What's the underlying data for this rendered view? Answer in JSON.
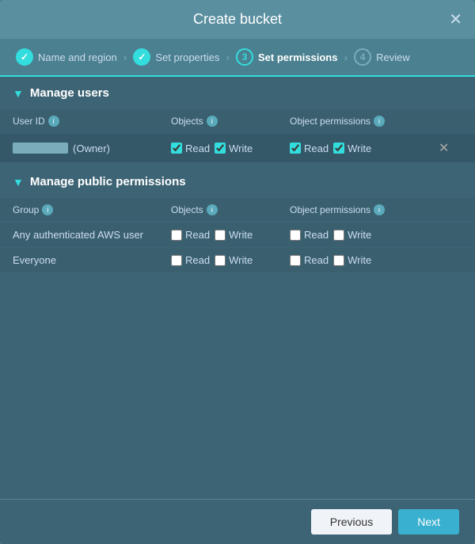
{
  "modal": {
    "title": "Create bucket",
    "close_icon": "✕"
  },
  "wizard": {
    "steps": [
      {
        "id": "name-region",
        "label": "Name and region",
        "state": "complete",
        "number": "✓"
      },
      {
        "id": "set-properties",
        "label": "Set properties",
        "state": "complete",
        "number": "✓"
      },
      {
        "id": "set-permissions",
        "label": "Set permissions",
        "state": "active",
        "number": "3"
      },
      {
        "id": "review",
        "label": "Review",
        "state": "inactive",
        "number": "4"
      }
    ]
  },
  "sections": {
    "manage_users": {
      "title": "Manage users",
      "columns": {
        "user_id": "User ID",
        "objects": "Objects",
        "object_permissions": "Object permissions"
      },
      "rows": [
        {
          "user_id_placeholder": "",
          "owner_label": "(Owner)",
          "obj_read_checked": true,
          "obj_write_checked": true,
          "perm_read_checked": true,
          "perm_write_checked": true
        }
      ]
    },
    "manage_public": {
      "title": "Manage public permissions",
      "columns": {
        "group": "Group",
        "objects": "Objects",
        "object_permissions": "Object permissions"
      },
      "rows": [
        {
          "group": "Any authenticated AWS user",
          "obj_read_checked": false,
          "obj_write_checked": false,
          "perm_read_checked": false,
          "perm_write_checked": false
        },
        {
          "group": "Everyone",
          "obj_read_checked": false,
          "obj_write_checked": false,
          "perm_read_checked": false,
          "perm_write_checked": false
        }
      ]
    }
  },
  "labels": {
    "read": "Read",
    "write": "Write",
    "previous": "Previous",
    "next": "Next"
  }
}
